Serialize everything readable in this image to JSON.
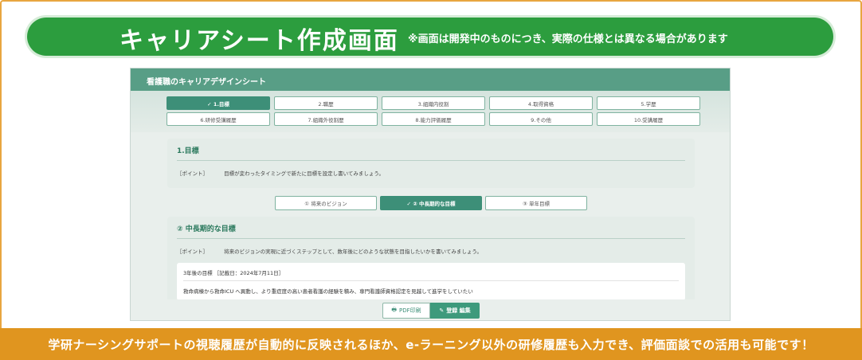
{
  "banner": {
    "title": "キャリアシート作成画面",
    "note": "※画面は開発中のものにつき、実際の仕様とは異なる場合があります"
  },
  "app": {
    "title": "看護職のキャリアデザインシート",
    "tabs_row1": [
      {
        "label": "✓ 1.目標",
        "active": true
      },
      {
        "label": "2.職歴",
        "active": false
      },
      {
        "label": "3.組織内役割",
        "active": false
      },
      {
        "label": "4.取得資格",
        "active": false
      },
      {
        "label": "5.学歴",
        "active": false
      }
    ],
    "tabs_row2": [
      {
        "label": "6.研修受講履歴",
        "active": false
      },
      {
        "label": "7.組織外役割歴",
        "active": false
      },
      {
        "label": "8.能力評価履歴",
        "active": false
      },
      {
        "label": "9.その他",
        "active": false
      },
      {
        "label": "10.受講履歴",
        "active": false
      }
    ],
    "goal_card": {
      "title": "1.目標",
      "point_label": "［ポイント］",
      "point_text": "目標が変わったタイミングで新たに目標を設定し書いてみましょう。"
    },
    "subtabs": [
      {
        "label": "① 将来のビジョン",
        "active": false
      },
      {
        "label": "✓ ② 中長期的な目標",
        "active": true
      },
      {
        "label": "③ 単年目標",
        "active": false
      }
    ],
    "mid_card": {
      "title": "② 中長期的な目標",
      "point_label": "［ポイント］",
      "point_text": "将来のビジョンの実現に近づくステップとして、数年後にどのような状態を目指したいかを書いてみましょう。",
      "entry_head": "3年後の目標 ［記載日：2024年7月11日］",
      "entry_text": "救命病棟から救命ICU へ異動し、より重症度の高い患者看護の経験を積み、専門看護師資格認定を見越して進学をしていたい"
    },
    "buttons": {
      "pdf": "PDF印刷",
      "save": "登録 編集"
    }
  },
  "footer": {
    "text": "学研ナーシングサポートの視聴履歴が自動的に反映されるほか、e-ラーニング以外の研修履歴も入力でき、評価面談での活用も可能です！"
  },
  "colors": {
    "banner_green": "#2c9d3e",
    "app_header": "#589e86",
    "accent": "#3d8f78",
    "footer_orange": "#e0951f"
  }
}
